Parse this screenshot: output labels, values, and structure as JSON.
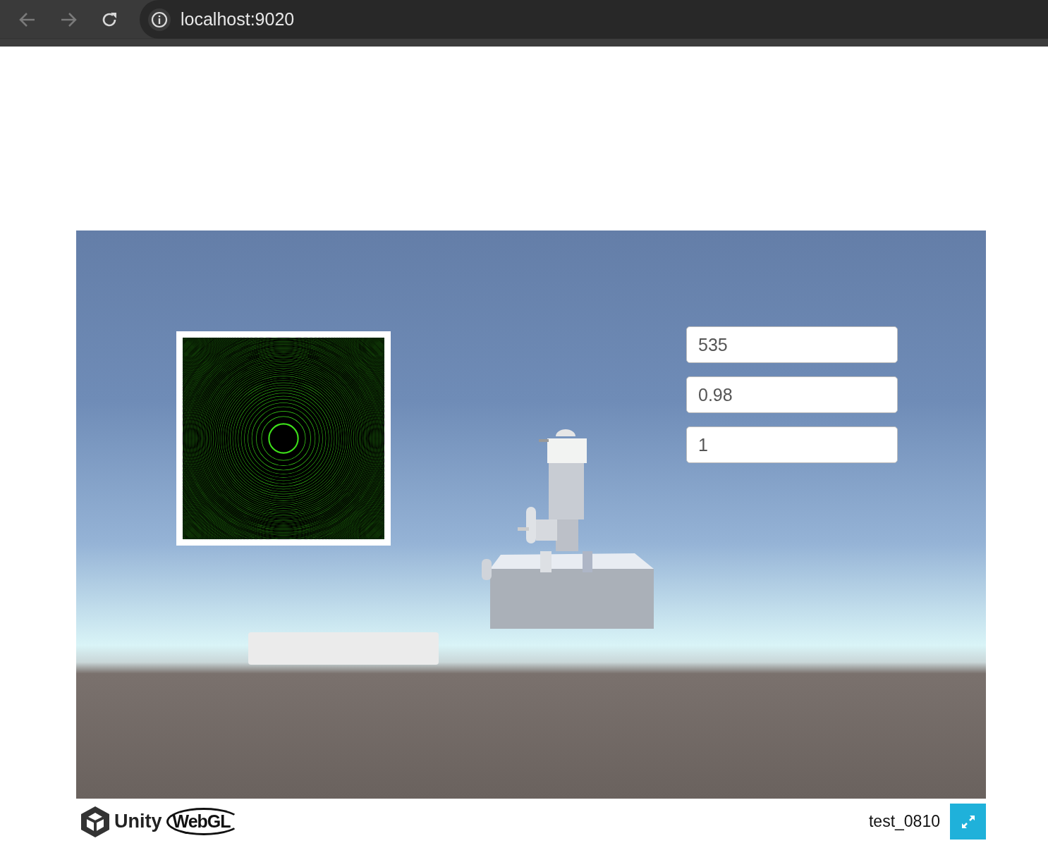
{
  "browser": {
    "url": "localhost:9020"
  },
  "scene": {
    "fields": [
      {
        "value": "535"
      },
      {
        "value": "0.98"
      },
      {
        "value": "1"
      }
    ]
  },
  "footer": {
    "logo_text": "Unity",
    "webgl_text": "WebGL",
    "title": "test_0810"
  }
}
